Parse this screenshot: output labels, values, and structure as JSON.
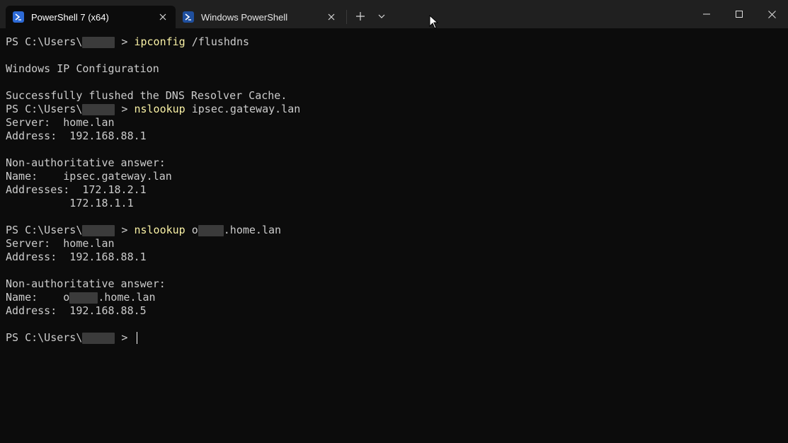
{
  "tabs": [
    {
      "label": "PowerShell 7 (x64)",
      "icon": "powershell-icon",
      "active": true
    },
    {
      "label": "Windows PowerShell",
      "icon": "powershell-icon",
      "active": false
    }
  ],
  "toolbar": {
    "new_tab": "+",
    "dropdown": "chevron-down-icon"
  },
  "window_controls": {
    "minimize": "minimize-icon",
    "maximize": "maximize-icon",
    "close": "close-icon"
  },
  "terminal": {
    "prompt_prefix": "PS C:\\Users\\",
    "prompt_suffix": " > ",
    "cmd1": {
      "cmd": "ipconfig",
      "args": " /flushdns"
    },
    "ipconfig_title": "Windows IP Configuration",
    "flushed": "Successfully flushed the DNS Resolver Cache.",
    "cmd2": {
      "cmd": "nslookup",
      "args": " ipsec.gateway.lan"
    },
    "out2": {
      "server": "Server:  home.lan",
      "address": "Address:  192.168.88.1",
      "nonauth": "Non-authoritative answer:",
      "name": "Name:    ipsec.gateway.lan",
      "addresses": "Addresses:  172.18.2.1",
      "addresses2": "          172.18.1.1"
    },
    "cmd3": {
      "cmd": "nslookup",
      "args_pre": " o",
      "args_post": ".home.lan"
    },
    "out3": {
      "server": "Server:  home.lan",
      "address": "Address:  192.168.88.1",
      "nonauth": "Non-authoritative answer:",
      "name_pre": "Name:    o",
      "name_post": ".home.lan",
      "address2": "Address:  192.168.88.5"
    }
  },
  "colors": {
    "background": "#0c0c0c",
    "titlebar": "#202020",
    "text": "#cccccc",
    "command": "#f9f1a5"
  }
}
